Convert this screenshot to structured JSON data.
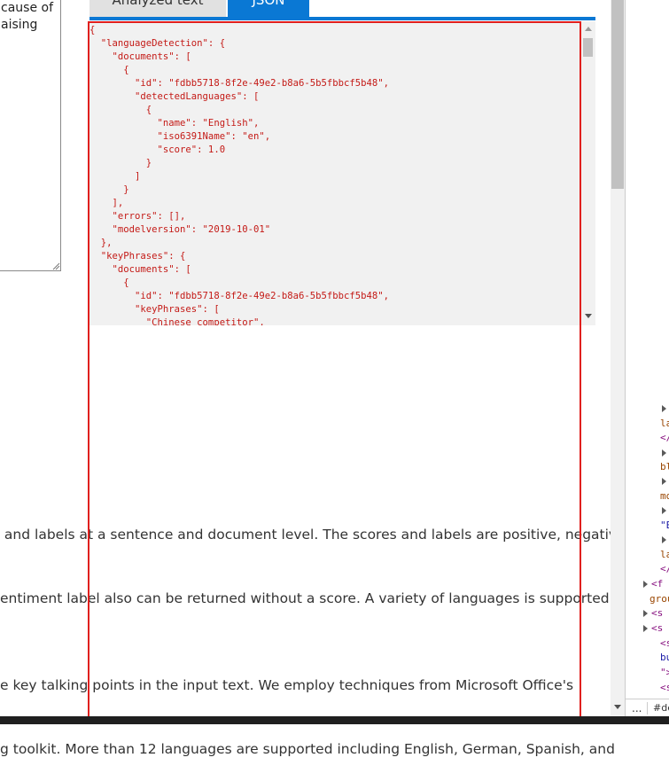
{
  "input": {
    "lines": [
      "cause of",
      "aising"
    ]
  },
  "tabs": [
    {
      "label": "Analyzed text",
      "active": false
    },
    {
      "label": "JSON",
      "active": true
    }
  ],
  "json_output": "{\n  \"languageDetection\": {\n    \"documents\": [\n      {\n        \"id\": \"fdbb5718-8f2e-49e2-b8a6-5b5fbbcf5b48\",\n        \"detectedLanguages\": [\n          {\n            \"name\": \"English\",\n            \"iso6391Name\": \"en\",\n            \"score\": 1.0\n          }\n        ]\n      }\n    ],\n    \"errors\": [],\n    \"modelversion\": \"2019-10-01\"\n  },\n  \"keyPhrases\": {\n    \"documents\": [\n      {\n        \"id\": \"fdbb5718-8f2e-49e2-b8a6-5b5fbbcf5b48\",\n        \"keyPhrases\": [\n          \"Chinese competitor\",",
  "paragraphs": [
    {
      "lines": [
        " and labels at a sentence and document level. The scores and labels are positive, negative, and",
        "entiment label also can be returned without a score. A variety of languages is supported."
      ]
    },
    {
      "lines": [
        "e key talking points in the input text. We employ techniques from Microsoft Office's",
        "g toolkit. More than 12 languages are supported including English, German, Spanish, and"
      ]
    }
  ],
  "devtools": {
    "lines": [
      {
        "text": "",
        "arrow": true,
        "color": "#881280"
      },
      {
        "text": "la",
        "arrow": false,
        "color": "#994500"
      },
      {
        "text": "</",
        "arrow": false,
        "color": "#881280"
      },
      {
        "text": "",
        "arrow": true,
        "color": "#881280"
      },
      {
        "text": "bl",
        "arrow": false,
        "color": "#994500"
      },
      {
        "text": "",
        "arrow": true,
        "color": "#881280"
      },
      {
        "text": "mo",
        "arrow": false,
        "color": "#994500"
      },
      {
        "text": "",
        "arrow": true,
        "color": "#881280"
      },
      {
        "text": "\"E",
        "arrow": false,
        "color": "#1a1aa6"
      },
      {
        "text": "",
        "arrow": true,
        "color": "#881280"
      },
      {
        "text": "la",
        "arrow": false,
        "color": "#994500"
      },
      {
        "text": "</",
        "arrow": false,
        "color": "#881280"
      },
      {
        "text": "<f",
        "arrow": true,
        "color": "#881280"
      },
      {
        "text": "grou",
        "arrow": false,
        "color": "#994500"
      },
      {
        "text": "<s",
        "arrow": true,
        "color": "#881280"
      },
      {
        "text": "<s",
        "arrow": true,
        "color": "#881280"
      },
      {
        "text": "<s",
        "arrow": false,
        "color": "#881280"
      },
      {
        "text": "bu",
        "arrow": false,
        "color": "#1a1aa6"
      },
      {
        "text": "\">",
        "arrow": false,
        "color": "#881280"
      },
      {
        "text": "<s",
        "arrow": false,
        "color": "#881280"
      }
    ],
    "footer_more": "...",
    "footer_hash": "#de"
  },
  "colors": {
    "accent": "#0a78d4",
    "highlight_border": "#e0201e",
    "json_text": "#c41a16"
  }
}
